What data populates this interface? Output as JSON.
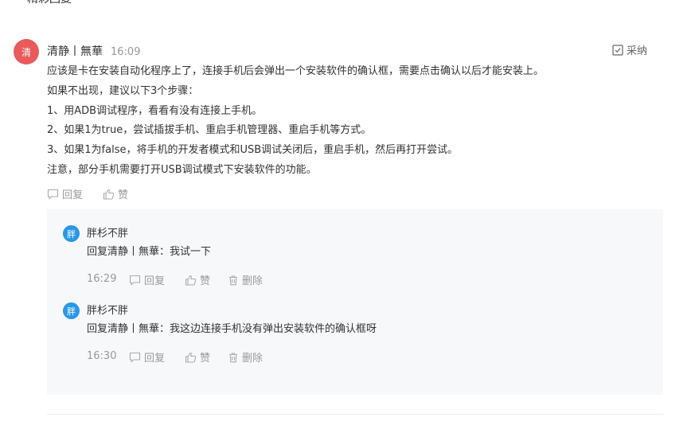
{
  "top_remnant": "精彩回复",
  "comment": {
    "avatar_char": "清",
    "author": "清静丨無華",
    "time": "16:09",
    "adopt_label": "采纳",
    "lines": [
      "应该是卡在安装自动化程序上了，连接手机后会弹出一个安装软件的确认框，需要点击确认以后才能安装上。",
      "如果不出现，建议以下3个步骤：",
      "1、用ADB调试程序，看看有没有连接上手机。",
      "2、如果1为true，尝试插拔手机、重启手机管理器、重启手机等方式。",
      "3、如果1为false，将手机的开发者模式和USB调试关闭后，重启手机，然后再打开尝试。",
      "注意，部分手机需要打开USB调试模式下安装软件的功能。"
    ],
    "reply_label": "回复",
    "like_label": "赞"
  },
  "replies": [
    {
      "avatar_char": "胖",
      "author": "胖杉不胖",
      "text": "回复清静丨無華：我试一下",
      "time": "16:29",
      "reply_label": "回复",
      "like_label": "赞",
      "delete_label": "删除"
    },
    {
      "avatar_char": "胖",
      "author": "胖杉不胖",
      "text": "回复清静丨無華：我这边连接手机没有弹出安装软件的确认框呀",
      "time": "16:30",
      "reply_label": "回复",
      "like_label": "赞",
      "delete_label": "删除"
    }
  ],
  "icons": {
    "adopt": "checkbox-check-icon",
    "reply": "speech-bubble-icon",
    "like": "thumbs-up-icon",
    "delete": "trash-icon"
  },
  "colors": {
    "main_avatar": "#e95a5a",
    "sub_avatar": "#2a97e8",
    "reply_box_bg": "#f7f8fa",
    "muted_text": "#999999"
  }
}
